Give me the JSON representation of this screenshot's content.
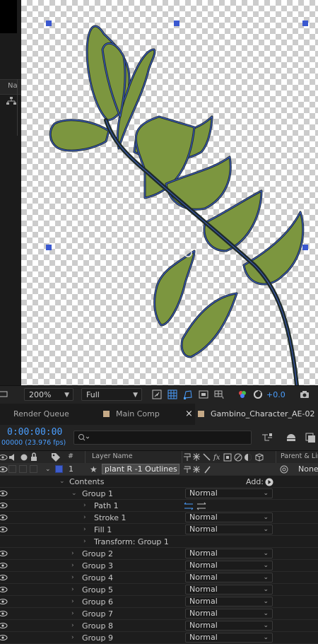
{
  "left_panel": {
    "column_label": "Na"
  },
  "viewer": {
    "zoom": "200%",
    "resolution": "Full",
    "exposure": "+0.0",
    "colors": {
      "leaf_fill": "#7c963f",
      "stem": "#1f2b2a",
      "outline": "#3a5cc4",
      "handle": "#3a58d0"
    }
  },
  "tabs": {
    "render_queue": "Render Queue",
    "main_comp": "Main Comp",
    "close_glyph": "×",
    "active_comp": "Gambino_Character_AE-02"
  },
  "timeline": {
    "timecode": "0:00:00:00",
    "fps": "00000 (23.976 fps)",
    "search_placeholder": "",
    "columns": {
      "number": "#",
      "layer_name": "Layer Name",
      "parent": "Parent & Link"
    }
  },
  "layer": {
    "index": "1",
    "name": "plant R -1 Outlines",
    "parent": "None",
    "label_color": "#3d5ccc"
  },
  "contents": {
    "label": "Contents",
    "add_label": "Add:"
  },
  "group1": {
    "name": "Group 1",
    "mode": "Normal",
    "children": {
      "path": "Path 1",
      "stroke": {
        "name": "Stroke 1",
        "mode": "Normal"
      },
      "fill": {
        "name": "Fill 1",
        "mode": "Normal"
      },
      "transform": "Transform: Group 1"
    }
  },
  "groups": [
    {
      "name": "Group 2",
      "mode": "Normal"
    },
    {
      "name": "Group 3",
      "mode": "Normal"
    },
    {
      "name": "Group 4",
      "mode": "Normal"
    },
    {
      "name": "Group 5",
      "mode": "Normal"
    },
    {
      "name": "Group 6",
      "mode": "Normal"
    },
    {
      "name": "Group 7",
      "mode": "Normal"
    },
    {
      "name": "Group 8",
      "mode": "Normal"
    },
    {
      "name": "Group 9",
      "mode": "Normal"
    }
  ]
}
